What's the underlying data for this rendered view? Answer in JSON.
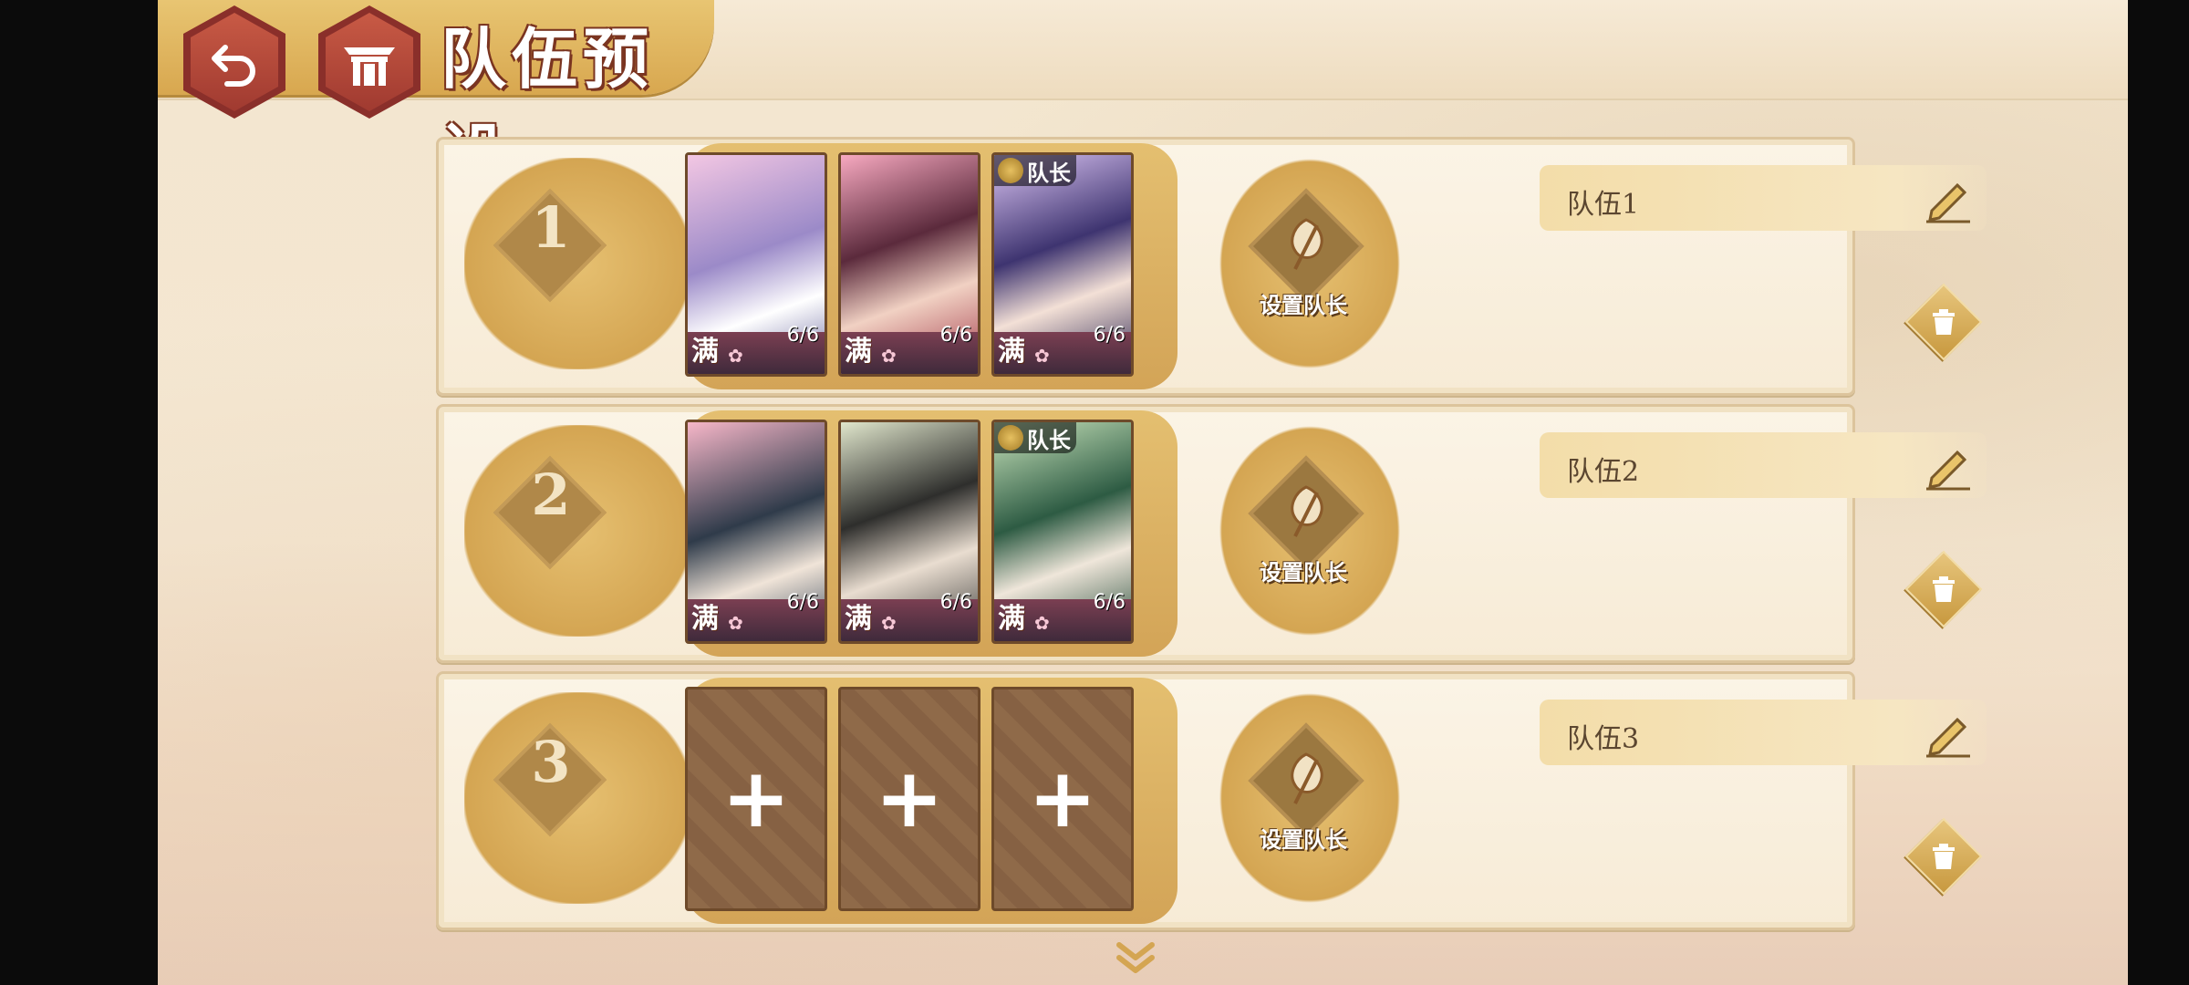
{
  "header": {
    "title": "队伍预设",
    "back_icon": "back-arrow-icon",
    "home_icon": "home-shrine-icon"
  },
  "teams": [
    {
      "number": "1",
      "name": "队伍1",
      "set_leader_label": "设置队长",
      "slots": [
        {
          "filled": true,
          "level": "6/6",
          "full_tag": "满",
          "flower": "✿",
          "leader": false,
          "palette": [
            "#f0c0e0",
            "#7a6fb0"
          ]
        },
        {
          "filled": true,
          "level": "6/6",
          "full_tag": "满",
          "flower": "✿",
          "leader": false,
          "palette": [
            "#f5a0b5",
            "#7a3a50"
          ]
        },
        {
          "filled": true,
          "level": "6/6",
          "full_tag": "满",
          "flower": "✿",
          "leader": true,
          "leader_label": "队长",
          "palette": [
            "#d8c0f0",
            "#4a3c78"
          ]
        }
      ]
    },
    {
      "number": "2",
      "name": "队伍2",
      "set_leader_label": "设置队长",
      "slots": [
        {
          "filled": true,
          "level": "6/6",
          "full_tag": "满",
          "flower": "✿",
          "leader": false,
          "palette": [
            "#f4b8c8",
            "#3a4a5a"
          ]
        },
        {
          "filled": true,
          "level": "6/6",
          "full_tag": "满",
          "flower": "✿",
          "leader": false,
          "palette": [
            "#d8e0c8",
            "#3a3a38"
          ]
        },
        {
          "filled": true,
          "level": "6/6",
          "full_tag": "满",
          "flower": "✿",
          "leader": true,
          "leader_label": "队长",
          "palette": [
            "#c8e0b8",
            "#2f5a44"
          ]
        }
      ]
    },
    {
      "number": "3",
      "name": "队伍3",
      "set_leader_label": "设置队长",
      "slots": [
        {
          "filled": false,
          "plus": "+"
        },
        {
          "filled": false,
          "plus": "+"
        },
        {
          "filled": false,
          "plus": "+"
        }
      ]
    }
  ]
}
